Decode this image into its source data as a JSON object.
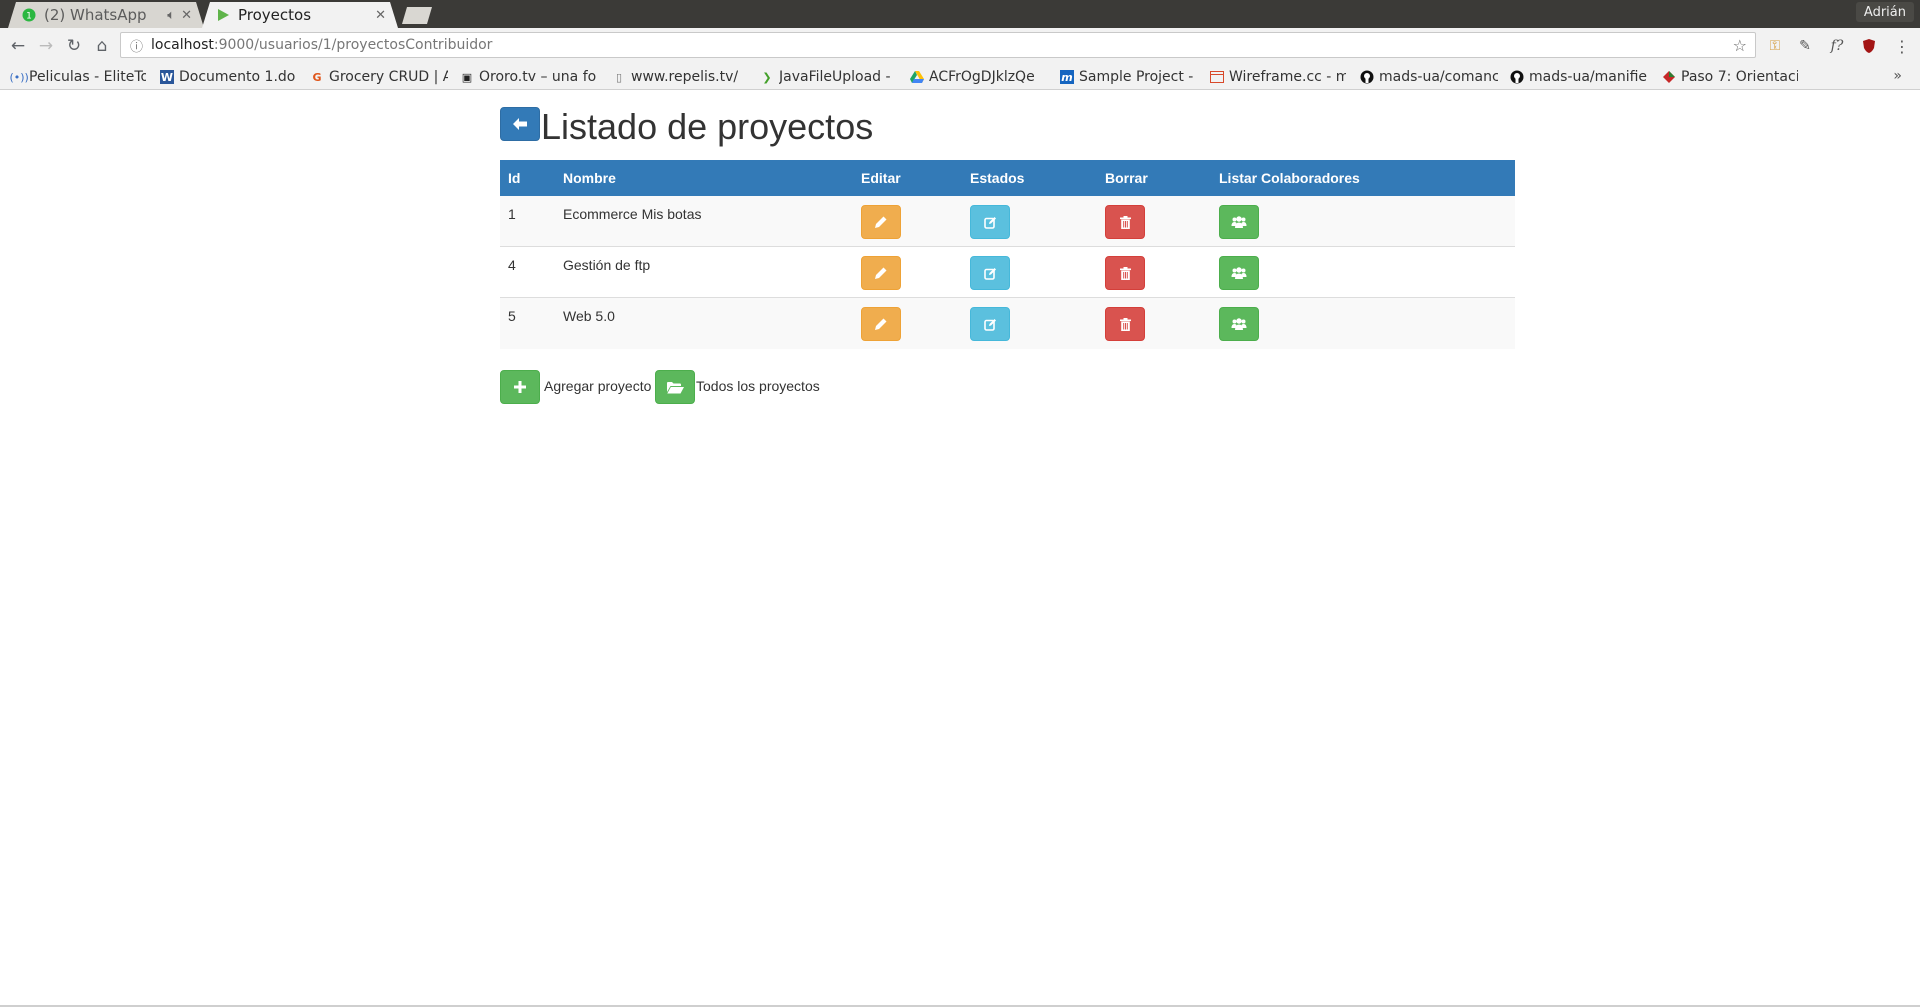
{
  "browser": {
    "tabs": [
      {
        "title": "(2) WhatsApp",
        "badge": "1",
        "active": false
      },
      {
        "title": "Proyectos",
        "active": true
      }
    ],
    "profile_name": "Adrián",
    "url_host": "localhost",
    "url_rest": ":9000/usuarios/1/proyectosContribuidor",
    "bookmarks": [
      {
        "label": "Peliculas - EliteTo",
        "icon": "radio-icon"
      },
      {
        "label": "Documento 1.do",
        "icon": "word-icon"
      },
      {
        "label": "Grocery CRUD | A",
        "icon": "grocery-icon"
      },
      {
        "label": "Ororo.tv – una fo",
        "icon": "tv-icon"
      },
      {
        "label": "www.repelis.tv/",
        "icon": "page-icon"
      },
      {
        "label": "JavaFileUpload -",
        "icon": "arrow-icon"
      },
      {
        "label": "ACFrOgDJklzQe",
        "icon": "drive-icon"
      },
      {
        "label": "Sample Project -",
        "icon": "m-icon"
      },
      {
        "label": "Wireframe.cc - m",
        "icon": "wireframe-icon"
      },
      {
        "label": "mads-ua/comanc",
        "icon": "github-icon"
      },
      {
        "label": "mads-ua/manifie",
        "icon": "github-icon"
      },
      {
        "label": "Paso 7: Orientaci",
        "icon": "paso-icon"
      }
    ],
    "bookmarks_more": "»"
  },
  "page": {
    "title": "Listado de proyectos",
    "columns": {
      "id": "Id",
      "nombre": "Nombre",
      "editar": "Editar",
      "estados": "Estados",
      "borrar": "Borrar",
      "colaboradores": "Listar Colaboradores"
    },
    "rows": [
      {
        "id": "1",
        "nombre": "Ecommerce Mis botas"
      },
      {
        "id": "4",
        "nombre": "Gestión de ftp"
      },
      {
        "id": "5",
        "nombre": "Web 5.0"
      }
    ],
    "add_label": "Agregar proyecto",
    "all_label": "Todos los proyectos"
  },
  "colors": {
    "primary": "#337ab7",
    "warning": "#f0ad4e",
    "info": "#5bc0de",
    "danger": "#d9534f",
    "success": "#5cb85c"
  }
}
